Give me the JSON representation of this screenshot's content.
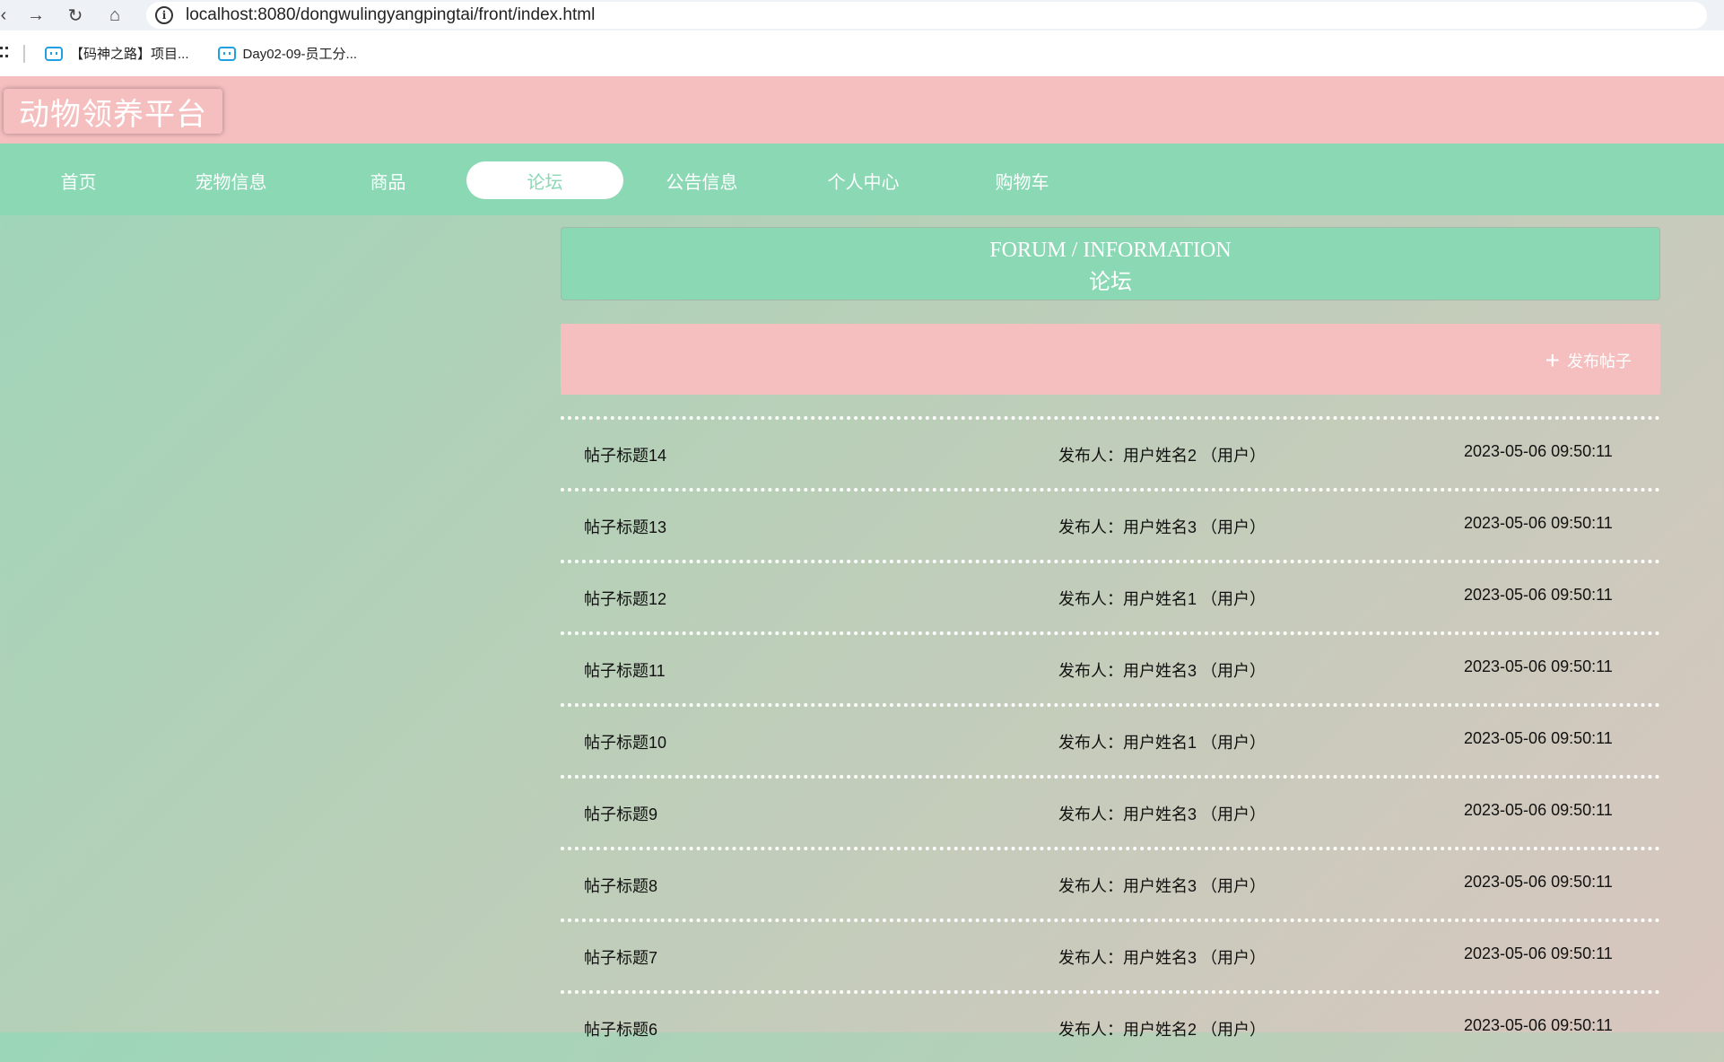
{
  "browser": {
    "url": "localhost:8080/dongwulingyangpingtai/front/index.html",
    "bookmarks": [
      {
        "label": "【码神之路】项目..."
      },
      {
        "label": "Day02-09-员工分..."
      }
    ]
  },
  "header": {
    "logo": "动物领养平台"
  },
  "nav": {
    "items": [
      {
        "label": "首页"
      },
      {
        "label": "宠物信息"
      },
      {
        "label": "商品"
      },
      {
        "label": "论坛"
      },
      {
        "label": "公告信息"
      },
      {
        "label": "个人中心"
      },
      {
        "label": "购物车"
      }
    ],
    "active": "论坛"
  },
  "forum": {
    "title_en": "FORUM / INFORMATION",
    "title_cn": "论坛",
    "post_button": "发布帖子",
    "posts": [
      {
        "title": "帖子标题14",
        "author": "发布人：用户姓名2 （用户）",
        "time": "2023-05-06 09:50:11"
      },
      {
        "title": "帖子标题13",
        "author": "发布人：用户姓名3 （用户）",
        "time": "2023-05-06 09:50:11"
      },
      {
        "title": "帖子标题12",
        "author": "发布人：用户姓名1 （用户）",
        "time": "2023-05-06 09:50:11"
      },
      {
        "title": "帖子标题11",
        "author": "发布人：用户姓名3 （用户）",
        "time": "2023-05-06 09:50:11"
      },
      {
        "title": "帖子标题10",
        "author": "发布人：用户姓名1 （用户）",
        "time": "2023-05-06 09:50:11"
      },
      {
        "title": "帖子标题9",
        "author": "发布人：用户姓名3 （用户）",
        "time": "2023-05-06 09:50:11"
      },
      {
        "title": "帖子标题8",
        "author": "发布人：用户姓名3 （用户）",
        "time": "2023-05-06 09:50:11"
      },
      {
        "title": "帖子标题7",
        "author": "发布人：用户姓名3 （用户）",
        "time": "2023-05-06 09:50:11"
      },
      {
        "title": "帖子标题6",
        "author": "发布人：用户姓名2 （用户）",
        "time": "2023-05-06 09:50:11"
      }
    ]
  },
  "colors": {
    "pink": "#f5bfc0",
    "green": "#8ad8b4"
  }
}
